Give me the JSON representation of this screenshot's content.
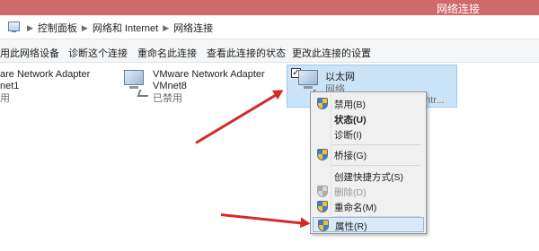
{
  "window": {
    "title": "网络连接"
  },
  "breadcrumb": [
    "控制面板",
    "网络和 Internet",
    "网络连接"
  ],
  "toolbar": {
    "buttons": [
      "用此网络设备",
      "诊断这个连接",
      "重命名此连接",
      "查看此连接的状态",
      "更改此连接的设置"
    ]
  },
  "adapters": [
    {
      "name": "are Network Adapter",
      "sub": "net1",
      "status": "用"
    },
    {
      "name": "VMware Network Adapter",
      "sub": "VMnet8",
      "status": "已禁用"
    },
    {
      "name": "以太网",
      "sub": "网络",
      "status": "ontr..."
    }
  ],
  "context_menu": {
    "items": [
      {
        "label": "禁用(B)",
        "shield": true
      },
      {
        "label": "状态(U)",
        "bold": true
      },
      {
        "label": "诊断(I)"
      },
      {
        "label": "桥接(G)",
        "shield": true
      },
      {
        "label": "创建快捷方式(S)"
      },
      {
        "label": "删除(D)",
        "shield": true,
        "disabled": true
      },
      {
        "label": "重命名(M)",
        "shield": true
      },
      {
        "label": "属性(R)",
        "shield": true,
        "highlighted": true
      }
    ]
  },
  "colors": {
    "titlebar": "#d06a6a",
    "selection": "#cce4f7",
    "arrow": "#d42a2a"
  }
}
